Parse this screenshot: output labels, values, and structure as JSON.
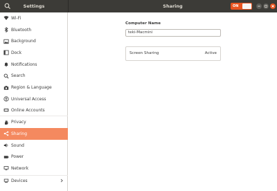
{
  "titlebar": {
    "left_title": "Settings",
    "center_title": "Sharing",
    "toggle_label": "ON"
  },
  "sidebar": {
    "items": [
      {
        "label": "Wi-Fi",
        "icon": "wifi-icon"
      },
      {
        "label": "Bluetooth",
        "icon": "bluetooth-icon"
      },
      {
        "label": "Background",
        "icon": "background-icon"
      },
      {
        "label": "Dock",
        "icon": "dock-icon"
      },
      {
        "label": "Notifications",
        "icon": "bell-icon"
      },
      {
        "label": "Search",
        "icon": "search-icon"
      },
      {
        "label": "Region & Language",
        "icon": "camera-icon"
      },
      {
        "label": "Universal Access",
        "icon": "accessibility-icon"
      },
      {
        "label": "Online Accounts",
        "icon": "cloud-icon"
      },
      {
        "label": "Privacy",
        "icon": "hand-icon"
      },
      {
        "label": "Sharing",
        "icon": "share-icon"
      },
      {
        "label": "Sound",
        "icon": "speaker-icon"
      },
      {
        "label": "Power",
        "icon": "power-icon"
      },
      {
        "label": "Network",
        "icon": "network-icon"
      },
      {
        "label": "Devices",
        "icon": "devices-icon"
      }
    ]
  },
  "main": {
    "computer_name_label": "Computer Name",
    "computer_name_value": "teki-Macmini",
    "screen_sharing_label": "Screen Sharing",
    "screen_sharing_status": "Active"
  },
  "colors": {
    "accent": "#e95420",
    "sidebar_active": "#f4895f",
    "titlebar": "#3c3b37"
  }
}
